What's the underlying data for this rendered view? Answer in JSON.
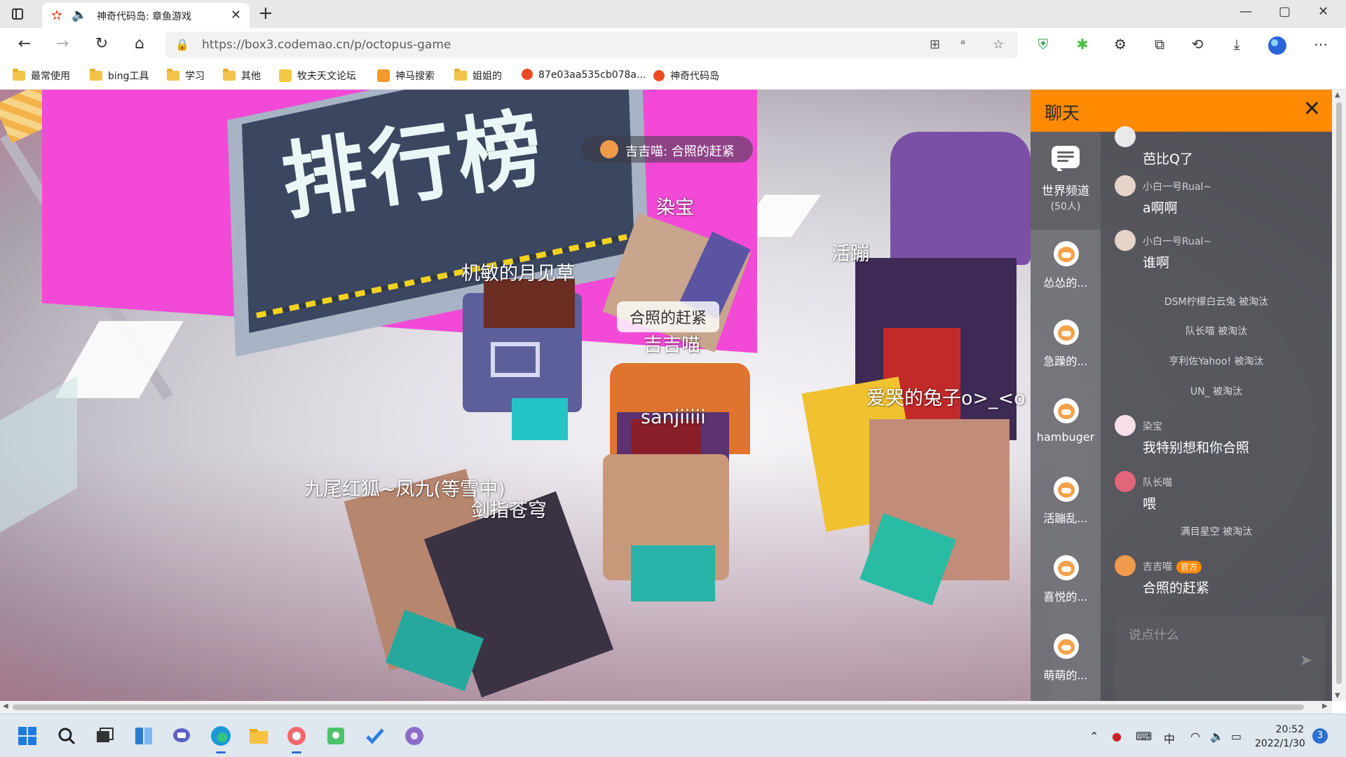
{
  "browser": {
    "tab": {
      "title": "神奇代码岛: 章鱼游戏",
      "close": "✕"
    },
    "new_tab": "+",
    "window_controls": {
      "minimize": "—",
      "maximize": "▢",
      "close": "✕"
    },
    "nav": {
      "back": "←",
      "forward": "→",
      "reload": "↻",
      "home": "⌂"
    },
    "url": "https://box3.codemao.cn/p/octopus-game",
    "bookmarks": [
      {
        "label": "最常使用",
        "icon": "folder-icon"
      },
      {
        "label": "bing工具",
        "icon": "folder-icon"
      },
      {
        "label": "学习",
        "icon": "folder-icon"
      },
      {
        "label": "其他",
        "icon": "folder-icon"
      },
      {
        "label": "牧夫天文论坛",
        "icon": "site-icon"
      },
      {
        "label": "神马搜索",
        "icon": "site-icon"
      },
      {
        "label": "姐姐的",
        "icon": "folder-icon"
      },
      {
        "label": "87e03aa535cb078a...",
        "icon": "codemao-icon"
      },
      {
        "label": "神奇代码岛",
        "icon": "codemao-icon"
      }
    ]
  },
  "game": {
    "board_text": "排行榜",
    "toast": "吉吉喵: 合照的赶紧",
    "players": [
      {
        "name": "染宝"
      },
      {
        "name": "机敏的月见草"
      },
      {
        "name": "吉吉喵"
      },
      {
        "name": "sanjiiiii"
      },
      {
        "name": "爱哭的兔子o>_<o"
      },
      {
        "name": "九尾红狐~凤九(等雪中)"
      },
      {
        "name": "剑指苍穹"
      },
      {
        "name": "活蹦"
      }
    ],
    "speech_bubble": "合照的赶紧"
  },
  "chat": {
    "title": "聊天",
    "close": "✕",
    "world_channel": {
      "label": "世界频道",
      "count": "(50人)"
    },
    "members": [
      {
        "label": "怂怂的..."
      },
      {
        "label": "急躁的..."
      },
      {
        "label": "hambuger"
      },
      {
        "label": "活蹦乱..."
      },
      {
        "label": "喜悦的..."
      },
      {
        "label": "萌萌的..."
      }
    ],
    "messages": [
      {
        "name": "",
        "text": "芭比Q了"
      },
      {
        "name": "小白一号Rual~",
        "text": "a啊啊"
      },
      {
        "name": "小白一号Rual~",
        "text": "谁啊"
      },
      {
        "name": "染宝",
        "text": "我特别想和你合照"
      },
      {
        "name": "队长喵",
        "text": "喂"
      },
      {
        "name": "吉吉喵",
        "badge": "官方",
        "text": "合照的赶紧"
      }
    ],
    "system": [
      "DSM柠檬白云兔 被淘汰",
      "队长喵 被淘汰",
      "亨利佐Yahoo! 被淘汰",
      "UN_ 被淘汰",
      "满目星空 被淘汰"
    ],
    "input_placeholder": "说点什么",
    "send": "➤"
  },
  "taskbar": {
    "ime": "中",
    "time": "20:52",
    "date": "2022/1/30",
    "notifications": "3"
  },
  "colors": {
    "chat_header": "#ff8a00",
    "board_pink": "#f24ad6",
    "badge": "#ff8a00"
  }
}
